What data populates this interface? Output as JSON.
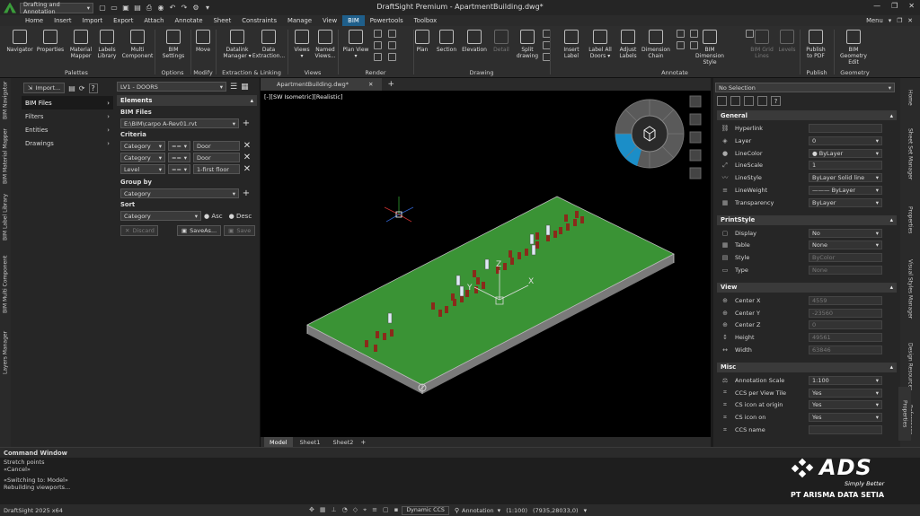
{
  "title_bar": {
    "workspace": "Drafting and Annotation",
    "title": "DraftSight Premium - ApartmentBuilding.dwg*"
  },
  "menus": [
    "Home",
    "Insert",
    "Import",
    "Export",
    "Attach",
    "Annotate",
    "Sheet",
    "Constraints",
    "Manage",
    "View",
    "BIM",
    "Powertools",
    "Toolbox"
  ],
  "active_menu": "BIM",
  "menu_right": "Menu",
  "ribbon": {
    "buttons": [
      {
        "label": "Navigator"
      },
      {
        "label": "Properties"
      },
      {
        "label": "Material\nMapper"
      },
      {
        "label": "Labels\nLibrary"
      },
      {
        "label": "Multi\nComponent"
      },
      {
        "label": "BIM\nSettings"
      },
      {
        "label": "Move"
      },
      {
        "label": "Datalink\nManager ▾"
      },
      {
        "label": "Data\nExtraction..."
      },
      {
        "label": "Views\n▾"
      },
      {
        "label": "Named\nViews..."
      },
      {
        "label": "Plan View\n▾"
      },
      {
        "label": "Plan"
      },
      {
        "label": "Section"
      },
      {
        "label": "Elevation"
      },
      {
        "label": "Detail"
      },
      {
        "label": "Split\ndrawing"
      },
      {
        "label": "Insert\nLabel"
      },
      {
        "label": "Label All\nDoors ▾"
      },
      {
        "label": "Adjust\nLabels"
      },
      {
        "label": "Dimension\nChain"
      },
      {
        "label": "BIM Dimension\nStyle"
      },
      {
        "label": "BIM Grid\nLines"
      },
      {
        "label": "Levels"
      },
      {
        "label": "Publish\nto PDF"
      },
      {
        "label": "BIM Geometry\nEdit"
      }
    ],
    "groups": [
      "Palettes",
      "Options",
      "Modify",
      "Extraction & Linking",
      "Views",
      "Render",
      "Drawing",
      "Annotate",
      "Publish",
      "Geometry"
    ]
  },
  "left_tabs": [
    "BIM Navigator",
    "BIM Material Mapper",
    "BIM Label Library",
    "BIM Multi Component",
    "Layers Manager"
  ],
  "left_bottom_tab": "BIM Navigator",
  "navigator": {
    "import_label": "Import...",
    "tree": [
      {
        "label": "BIM Files"
      },
      {
        "label": "Filters"
      },
      {
        "label": "Entities"
      },
      {
        "label": "Drawings"
      }
    ],
    "filter_select": "LV1 - DOORS",
    "elements_header": "Elements",
    "bim_files_label": "BIM Files",
    "bim_file_value": "E:\\BIM\\carpo A-Rev01.rvt",
    "criteria_label": "Criteria",
    "criteria": [
      {
        "field": "Category",
        "op": "==",
        "value": "Door"
      },
      {
        "field": "Category",
        "op": "==",
        "value": "Door"
      },
      {
        "field": "Level",
        "op": "==",
        "value": "1-first floor"
      }
    ],
    "group_by_label": "Group by",
    "group_by_value": "Category",
    "sort_label": "Sort",
    "sort_value": "Category",
    "asc_label": "Asc",
    "desc_label": "Desc",
    "discard_label": "Discard",
    "saveas_label": "SaveAs...",
    "save_label": "Save"
  },
  "viewport": {
    "doc_tab": "ApartmentBuilding.dwg*",
    "view_label": "[-][SW Isometric][Realistic]",
    "sheet_tabs": [
      "Model",
      "Sheet1",
      "Sheet2"
    ],
    "slab_color": "#3fa03a",
    "door_color": "#8a2a1a"
  },
  "properties": {
    "selection": "No Selection",
    "sections": {
      "general": "General",
      "printstyle": "PrintStyle",
      "view": "View",
      "misc": "Misc"
    },
    "general": [
      {
        "label": "Hyperlink",
        "value": ""
      },
      {
        "label": "Layer",
        "value": "0"
      },
      {
        "label": "LineColor",
        "value": "● ByLayer"
      },
      {
        "label": "LineScale",
        "value": "1"
      },
      {
        "label": "LineStyle",
        "value": "ByLayer    Solid line"
      },
      {
        "label": "LineWeight",
        "value": "——— ByLayer"
      },
      {
        "label": "Transparency",
        "value": "ByLayer"
      }
    ],
    "printstyle": [
      {
        "label": "Display",
        "value": "No"
      },
      {
        "label": "Table",
        "value": "None"
      },
      {
        "label": "Style",
        "value": "ByColor"
      },
      {
        "label": "Type",
        "value": "None"
      }
    ],
    "view": [
      {
        "label": "Center X",
        "value": "4559"
      },
      {
        "label": "Center Y",
        "value": "-23560"
      },
      {
        "label": "Center Z",
        "value": "0"
      },
      {
        "label": "Height",
        "value": "49561"
      },
      {
        "label": "Width",
        "value": "63846"
      }
    ],
    "misc": [
      {
        "label": "Annotation Scale",
        "value": "1:100"
      },
      {
        "label": "CCS per View Tile",
        "value": "Yes"
      },
      {
        "label": "CS icon at origin",
        "value": "Yes"
      },
      {
        "label": "CS icon on",
        "value": "Yes"
      },
      {
        "label": "CCS name",
        "value": ""
      }
    ]
  },
  "right_tabs": [
    "Home",
    "Sheet Set Manager",
    "Properties",
    "Visual Styles Manager",
    "Design Resources",
    "References"
  ],
  "right_bottom_tab": "Properties",
  "command_window": {
    "header": "Command Window",
    "lines": [
      "Stretch points",
      "«Cancel»",
      "",
      "«Switching to: Model»",
      "Rebuilding viewports..."
    ]
  },
  "status": {
    "app": "DraftSight 2025 x64",
    "dynamic_ccs": "Dynamic CCS",
    "annotation": "Annotation",
    "scale": "(1:100)",
    "coords": "(7935,28033,0)"
  },
  "watermark": {
    "brand": "ADS",
    "tagline": "Simply Better",
    "company": "PT ARISMA DATA SETIA"
  }
}
